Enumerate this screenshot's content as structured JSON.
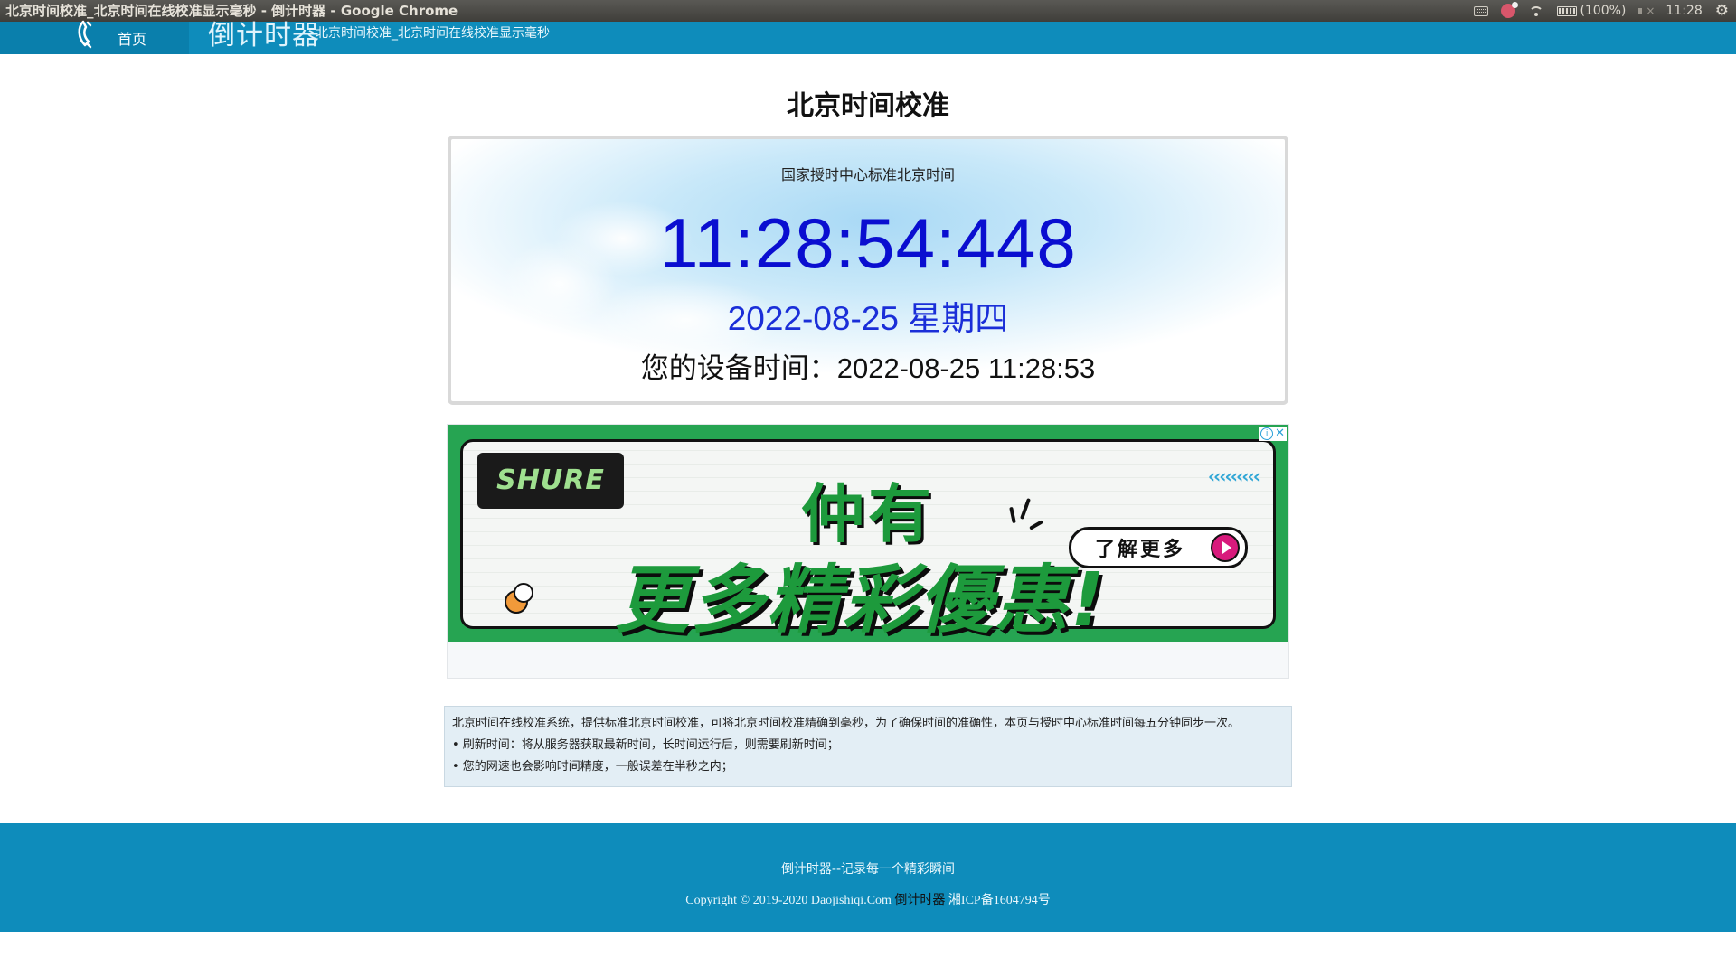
{
  "os": {
    "window_title": "北京时间校准_北京时间在线校准显示毫秒 - 倒计时器 - Google Chrome",
    "battery": "(100%)",
    "clock": "11:28"
  },
  "header": {
    "home_label": "首页",
    "brand_logo": "倒计时器",
    "brand_subtitle": "北京时间校准_北京时间在线校准显示毫秒"
  },
  "main": {
    "title": "北京时间校准",
    "clock": {
      "source_label": "国家授时中心标准北京时间",
      "time": "11:28:54:448",
      "date": "2022-08-25 星期四",
      "device_time": "您的设备时间：2022-08-25 11:28:53"
    }
  },
  "ad": {
    "brand": "SHURE",
    "headline_1": "仲有",
    "headline_2": "更多精彩優惠!",
    "cta": "了解更多",
    "chevrons": "‹‹‹‹‹‹‹‹‹",
    "accent_color": "#26a452"
  },
  "notes": {
    "intro": "北京时间在线校准系统，提供标准北京时间校准，可将北京时间校准精确到毫秒，为了确保时间的准确性，本页与授时中心标准时间每五分钟同步一次。",
    "tip_refresh": "• 刷新时间：将从服务器获取最新时间，长时间运行后，则需要刷新时间；",
    "tip_network": "• 您的网速也会影响时间精度，一般误差在半秒之内；"
  },
  "footer": {
    "slogan": "倒计时器--记录每一个精彩瞬间",
    "copyright": "Copyright © 2019-2020  Daojishiqi.Com ",
    "site_link": "倒计时器",
    "icp": " 湘ICP备1604794号"
  },
  "colors": {
    "header_bg": "#0e8cbb",
    "time_color": "#0a0ed0",
    "date_color": "#1a2ed8"
  }
}
